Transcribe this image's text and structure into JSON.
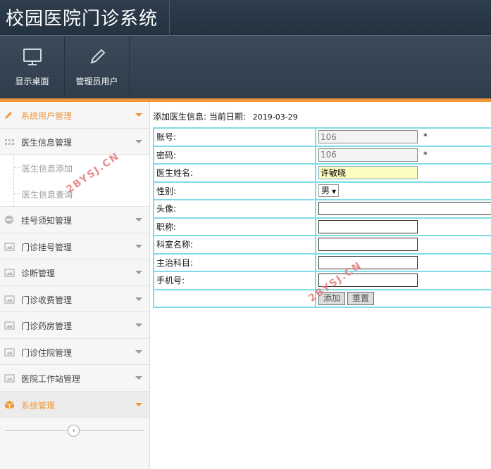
{
  "header": {
    "title": "校园医院门诊系统"
  },
  "toolbar": {
    "buttons": [
      {
        "label": "显示桌面",
        "icon": "monitor-icon"
      },
      {
        "label": "管理员用户",
        "icon": "pencil-icon"
      }
    ]
  },
  "sidebar": {
    "items": [
      {
        "label": "系统用户管理",
        "icon": "pencil-icon",
        "active": true
      },
      {
        "label": "医生信息管理",
        "icon": "grid-icon",
        "expanded": true,
        "children": [
          {
            "label": "医生信息添加"
          },
          {
            "label": "医生信息查询"
          }
        ]
      },
      {
        "label": "挂号须知管理",
        "icon": "minus-circle-icon"
      },
      {
        "label": "门诊挂号管理",
        "icon": "image-icon"
      },
      {
        "label": "诊断管理",
        "icon": "image-icon"
      },
      {
        "label": "门诊收费管理",
        "icon": "image-icon"
      },
      {
        "label": "门诊药房管理",
        "icon": "image-icon"
      },
      {
        "label": "门诊住院管理",
        "icon": "image-icon"
      },
      {
        "label": "医院工作站管理",
        "icon": "image-icon"
      },
      {
        "label": "系统管理",
        "icon": "box-icon",
        "active": true
      }
    ],
    "collapse_symbol": "‹"
  },
  "main": {
    "heading": "添加医生信息:",
    "date_label": "当前日期:",
    "date_value": "2019-03-29",
    "form": {
      "account_label": "账号:",
      "account_value": "106",
      "password_label": "密码:",
      "password_value": "106",
      "name_label": "医生姓名:",
      "name_value": "许敏晓",
      "gender_label": "性别:",
      "gender_value": "男",
      "avatar_label": "头像:",
      "avatar_value": "",
      "title_label": "职称:",
      "title_value": "",
      "dept_label": "科室名称:",
      "dept_value": "",
      "subject_label": "主治科目:",
      "subject_value": "",
      "phone_label": "手机号:",
      "phone_value": "",
      "required_mark": "*",
      "add_button": "添加",
      "reset_button": "重置"
    }
  },
  "watermark": "2BYSJ.CN",
  "colors": {
    "accent": "#f0963a",
    "header": "#2e3e4e",
    "table_border": "#7fdbe8"
  }
}
